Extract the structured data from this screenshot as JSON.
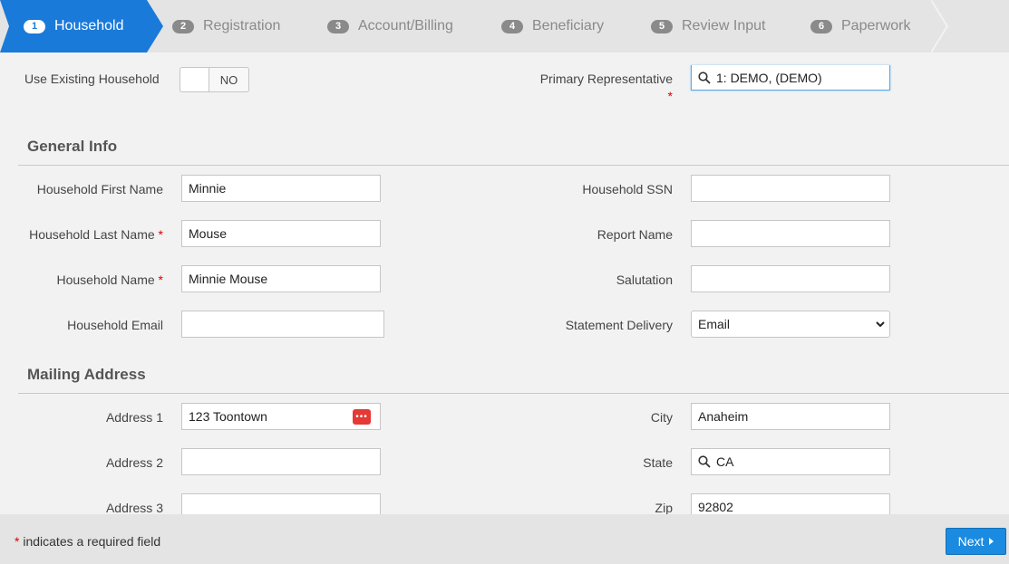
{
  "steps": [
    {
      "num": "1",
      "label": "Household"
    },
    {
      "num": "2",
      "label": "Registration"
    },
    {
      "num": "3",
      "label": "Account/Billing"
    },
    {
      "num": "4",
      "label": "Beneficiary"
    },
    {
      "num": "5",
      "label": "Review Input"
    },
    {
      "num": "6",
      "label": "Paperwork"
    }
  ],
  "top": {
    "use_existing_label": "Use Existing Household",
    "use_existing_value": "NO",
    "primary_rep_label": "Primary Representative",
    "primary_rep_value": "1: DEMO,  (DEMO)"
  },
  "general": {
    "title": "General Info",
    "first_name_label": "Household First Name",
    "first_name": "Minnie",
    "last_name_label": "Household Last Name",
    "last_name": "Mouse",
    "household_name_label": "Household Name",
    "household_name": "Minnie Mouse",
    "email_label": "Household Email",
    "email": "",
    "ssn_label": "Household SSN",
    "ssn": "",
    "report_name_label": "Report Name",
    "report_name": "",
    "salutation_label": "Salutation",
    "salutation": "",
    "statement_label": "Statement Delivery",
    "statement_value": "Email"
  },
  "mailing": {
    "title": "Mailing Address",
    "address1_label": "Address 1",
    "address1": "123 Toontown",
    "address2_label": "Address 2",
    "address2": "",
    "address3_label": "Address 3",
    "address3": "",
    "city_label": "City",
    "city": "Anaheim",
    "state_label": "State",
    "state": "CA",
    "zip_label": "Zip",
    "zip": "92802"
  },
  "required_marker": "*",
  "footer": {
    "note": "indicates a required field",
    "next_label": "Next"
  },
  "colors": {
    "accent": "#1a7ad9",
    "required": "#dd0000"
  }
}
